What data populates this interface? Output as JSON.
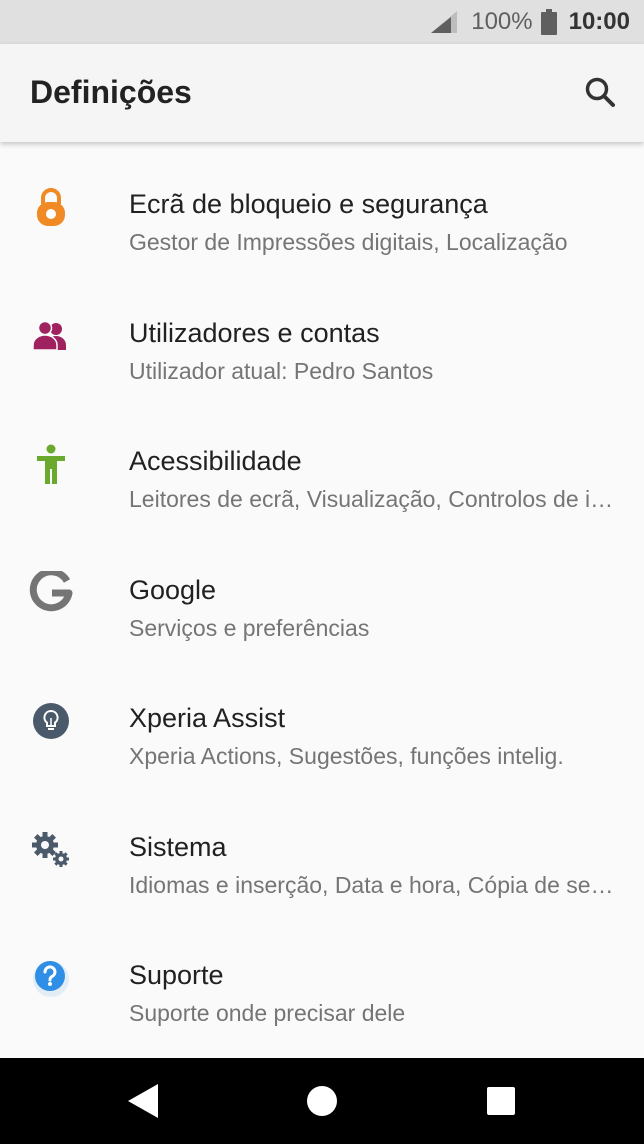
{
  "status_bar": {
    "battery_percent": "100%",
    "time": "10:00",
    "icons": [
      "signal-icon",
      "battery-icon"
    ]
  },
  "header": {
    "title": "Definições",
    "search_icon": "search-icon"
  },
  "settings_items": [
    {
      "title": "Ecrã de bloqueio e segurança",
      "subtitle": "Gestor de Impressões digitais, Localização",
      "icon": "lock-icon",
      "color": "#f08a24"
    },
    {
      "title": "Utilizadores e contas",
      "subtitle": "Utilizador atual: Pedro Santos",
      "icon": "users-icon",
      "color": "#a0215f"
    },
    {
      "title": "Acessibilidade",
      "subtitle": "Leitores de ecrã, Visualização, Controlos de interação",
      "icon": "accessibility-icon",
      "color": "#6aa82e"
    },
    {
      "title": "Google",
      "subtitle": "Serviços e preferências",
      "icon": "google-icon",
      "color": "#757575"
    },
    {
      "title": "Xperia Assist",
      "subtitle": "Xperia Actions, Sugestões, funções intelig.",
      "icon": "lightbulb-icon",
      "color": "#4a5a6b"
    },
    {
      "title": "Sistema",
      "subtitle": "Idiomas e inserção, Data e hora, Cópia de segurança",
      "icon": "gears-icon",
      "color": "#4a5a6b"
    },
    {
      "title": "Suporte",
      "subtitle": "Suporte onde precisar dele",
      "icon": "help-icon",
      "color": "#2f8fe6"
    }
  ],
  "nav_bar": {
    "icons": [
      "back-icon",
      "home-icon",
      "recents-icon"
    ]
  }
}
